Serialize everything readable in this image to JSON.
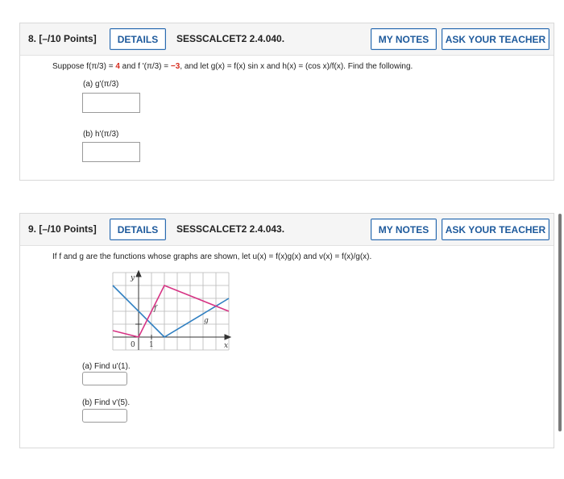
{
  "q8": {
    "number": "8.  [–/10 Points]",
    "details": "DETAILS",
    "code": "SESSCALCET2 2.4.040.",
    "my_notes": "MY NOTES",
    "ask_teacher": "ASK YOUR TEACHER",
    "prompt_parts": [
      "Suppose  f(π/3) = ",
      "4",
      " and f '(π/3) = ",
      "−3",
      ",  and let  g(x) = f(x) sin x  and  h(x) = (cos x)/f(x).  Find the following."
    ],
    "part_a": "(a)    g'(π/3)",
    "part_b": "(b)    h'(π/3)"
  },
  "q9": {
    "number": "9.  [–/10 Points]",
    "details": "DETAILS",
    "code": "SESSCALCET2 2.4.043.",
    "my_notes": "MY NOTES",
    "ask_teacher": "ASK YOUR TEACHER",
    "prompt": "If f and g are the functions whose graphs are shown, let u(x) = f(x)g(x) and v(x) = f(x)/g(x).",
    "part_a": "(a) Find u'(1).",
    "part_b": "(b) Find v'(5).",
    "graph": {
      "y_label": "y",
      "x_label": "x",
      "f_label": "f",
      "g_label": "g",
      "origin_label": "0",
      "tick_label": "1",
      "f_color": "#d63384",
      "g_color": "#2f7fc1"
    }
  }
}
